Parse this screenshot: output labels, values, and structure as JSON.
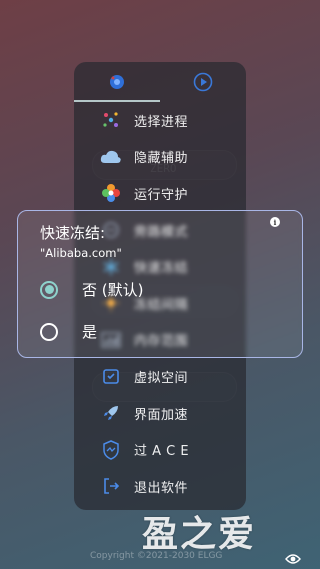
{
  "drawer": {
    "menu": [
      {
        "label": "选择进程",
        "icon": "sparkle-icon"
      },
      {
        "label": "隐藏辅助",
        "icon": "cloud-icon"
      },
      {
        "label": "运行守护",
        "icon": "flower-icon"
      },
      {
        "label": "旁路模式",
        "icon": "bypass-icon"
      },
      {
        "label": "快速冻结",
        "icon": "snowflake-icon"
      },
      {
        "label": "冻结间隔",
        "icon": "sun-icon"
      },
      {
        "label": "内存范围",
        "icon": "memory-chart-icon"
      },
      {
        "label": "虚拟空间",
        "icon": "virtual-space-icon"
      },
      {
        "label": "界面加速",
        "icon": "rocket-icon"
      },
      {
        "label": "过 A C E",
        "icon": "shield-icon"
      },
      {
        "label": "退出软件",
        "icon": "exit-icon"
      }
    ]
  },
  "dialog": {
    "title": "快速冻结:",
    "subtitle": "\"Alibaba.com\"",
    "options": [
      {
        "label": "否 (默认)",
        "checked": true
      },
      {
        "label": "是",
        "checked": false
      }
    ]
  },
  "footer": {
    "copyright": "Copyright ©2021-2030 ELGG",
    "watermark": "盈之爱"
  },
  "colors": {
    "accent": "#8ed2cc",
    "dialog_border": "#a9b6e6"
  }
}
